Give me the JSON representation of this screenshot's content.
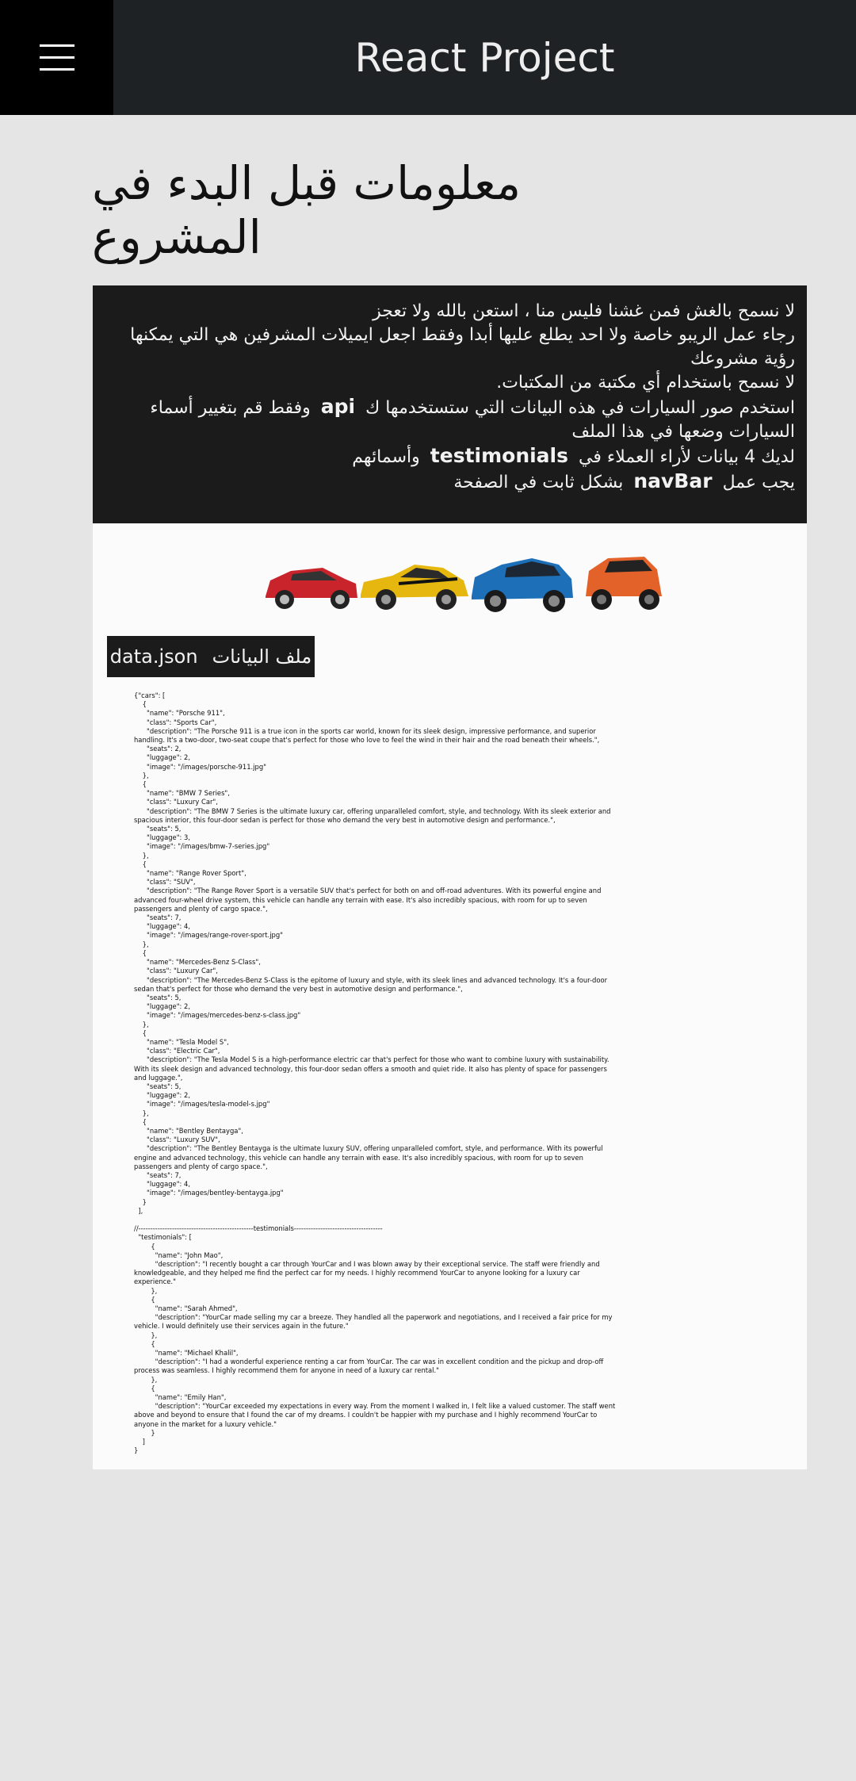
{
  "header": {
    "title": "React Project",
    "menu_icon": "hamburger-menu-icon"
  },
  "page": {
    "title": "معلومات قبل البدء في المشروع"
  },
  "rules": {
    "line1": "لا نسمح بالغش فمن غشنا فليس منا ، استعن بالله ولا تعجز",
    "line2": "رجاء عمل الريبو خاصة ولا احد يطلع عليها أبدا وفقط اجعل ايميلات المشرفين هي التي يمكنها رؤية مشروعك",
    "line3": "لا نسمح باستخدام أي مكتبة من المكتبات.",
    "line4_pre": "استخدم صور السيارات في هذه البيانات التي ستستخدمها ك",
    "line4_api": "api",
    "line4_post": "وفقط قم بتغيير أسماء",
    "line5": "السيارات وضعها في هذا الملف",
    "line6_pre": "لديك 4 بيانات لأراء العملاء في",
    "line6_en": "testimonials",
    "line6_post": "وأسمائهم",
    "line7_pre": "يجب عمل",
    "line7_en": "navBar",
    "line7_post": "بشكل ثابت في الصفحة"
  },
  "cars_image": {
    "colors": [
      "#c9232b",
      "#e6b80f",
      "#1d6fb8",
      "#e2622a"
    ]
  },
  "file_label": {
    "ar": "ملف البيانات",
    "en": "data.json"
  },
  "json_text": "{\"cars\": [\n    {\n      \"name\": \"Porsche 911\",\n      \"class\": \"Sports Car\",\n      \"description\": \"The Porsche 911 is a true icon in the sports car world, known for its sleek design, impressive performance, and superior handling. It's a two-door, two-seat coupe that's perfect for those who love to feel the wind in their hair and the road beneath their wheels.\",\n      \"seats\": 2,\n      \"luggage\": 2,\n      \"image\": \"/images/porsche-911.jpg\"\n    },\n    {\n      \"name\": \"BMW 7 Series\",\n      \"class\": \"Luxury Car\",\n      \"description\": \"The BMW 7 Series is the ultimate luxury car, offering unparalleled comfort, style, and technology. With its sleek exterior and spacious interior, this four-door sedan is perfect for those who demand the very best in automotive design and performance.\",\n      \"seats\": 5,\n      \"luggage\": 3,\n      \"image\": \"/images/bmw-7-series.jpg\"\n    },\n    {\n      \"name\": \"Range Rover Sport\",\n      \"class\": \"SUV\",\n      \"description\": \"The Range Rover Sport is a versatile SUV that's perfect for both on and off-road adventures. With its powerful engine and advanced four-wheel drive system, this vehicle can handle any terrain with ease. It's also incredibly spacious, with room for up to seven passengers and plenty of cargo space.\",\n      \"seats\": 7,\n      \"luggage\": 4,\n      \"image\": \"/images/range-rover-sport.jpg\"\n    },\n    {\n      \"name\": \"Mercedes-Benz S-Class\",\n      \"class\": \"Luxury Car\",\n      \"description\": \"The Mercedes-Benz S-Class is the epitome of luxury and style, with its sleek lines and advanced technology. It's a four-door sedan that's perfect for those who demand the very best in automotive design and performance.\",\n      \"seats\": 5,\n      \"luggage\": 2,\n      \"image\": \"/images/mercedes-benz-s-class.jpg\"\n    },\n    {\n      \"name\": \"Tesla Model S\",\n      \"class\": \"Electric Car\",\n      \"description\": \"The Tesla Model S is a high-performance electric car that's perfect for those who want to combine luxury with sustainability. With its sleek design and advanced technology, this four-door sedan offers a smooth and quiet ride. It also has plenty of space for passengers and luggage.\",\n      \"seats\": 5,\n      \"luggage\": 2,\n      \"image\": \"/images/tesla-model-s.jpg\"\n    },\n    {\n      \"name\": \"Bentley Bentayga\",\n      \"class\": \"Luxury SUV\",\n      \"description\": \"The Bentley Bentayga is the ultimate luxury SUV, offering unparalleled comfort, style, and performance. With its powerful engine and advanced technology, this vehicle can handle any terrain with ease. It's also incredibly spacious, with room for up to seven passengers and plenty of cargo space.\",\n      \"seats\": 7,\n      \"luggage\": 4,\n      \"image\": \"/images/bentley-bentayga.jpg\"\n    }\n  ],\n\n//------------------------------------------------testimonials-------------------------------------\n  \"testimonials\": [\n        {\n          \"name\": \"John Mao\",\n          \"description\": \"I recently bought a car through YourCar and I was blown away by their exceptional service. The staff were friendly and knowledgeable, and they helped me find the perfect car for my needs. I highly recommend YourCar to anyone looking for a luxury car experience.\"\n        },\n        {\n          \"name\": \"Sarah Ahmed\",\n          \"description\": \"YourCar made selling my car a breeze. They handled all the paperwork and negotiations, and I received a fair price for my vehicle. I would definitely use their services again in the future.\"\n        },\n        {\n          \"name\": \"Michael Khalil\",\n          \"description\": \"I had a wonderful experience renting a car from YourCar. The car was in excellent condition and the pickup and drop-off process was seamless. I highly recommend them for anyone in need of a luxury car rental.\"\n        },\n        {\n          \"name\": \"Emily Han\",\n          \"description\": \"YourCar exceeded my expectations in every way. From the moment I walked in, I felt like a valued customer. The staff went above and beyond to ensure that I found the car of my dreams. I couldn't be happier with my purchase and I highly recommend YourCar to anyone in the market for a luxury vehicle.\"\n        }\n    ]\n}"
}
